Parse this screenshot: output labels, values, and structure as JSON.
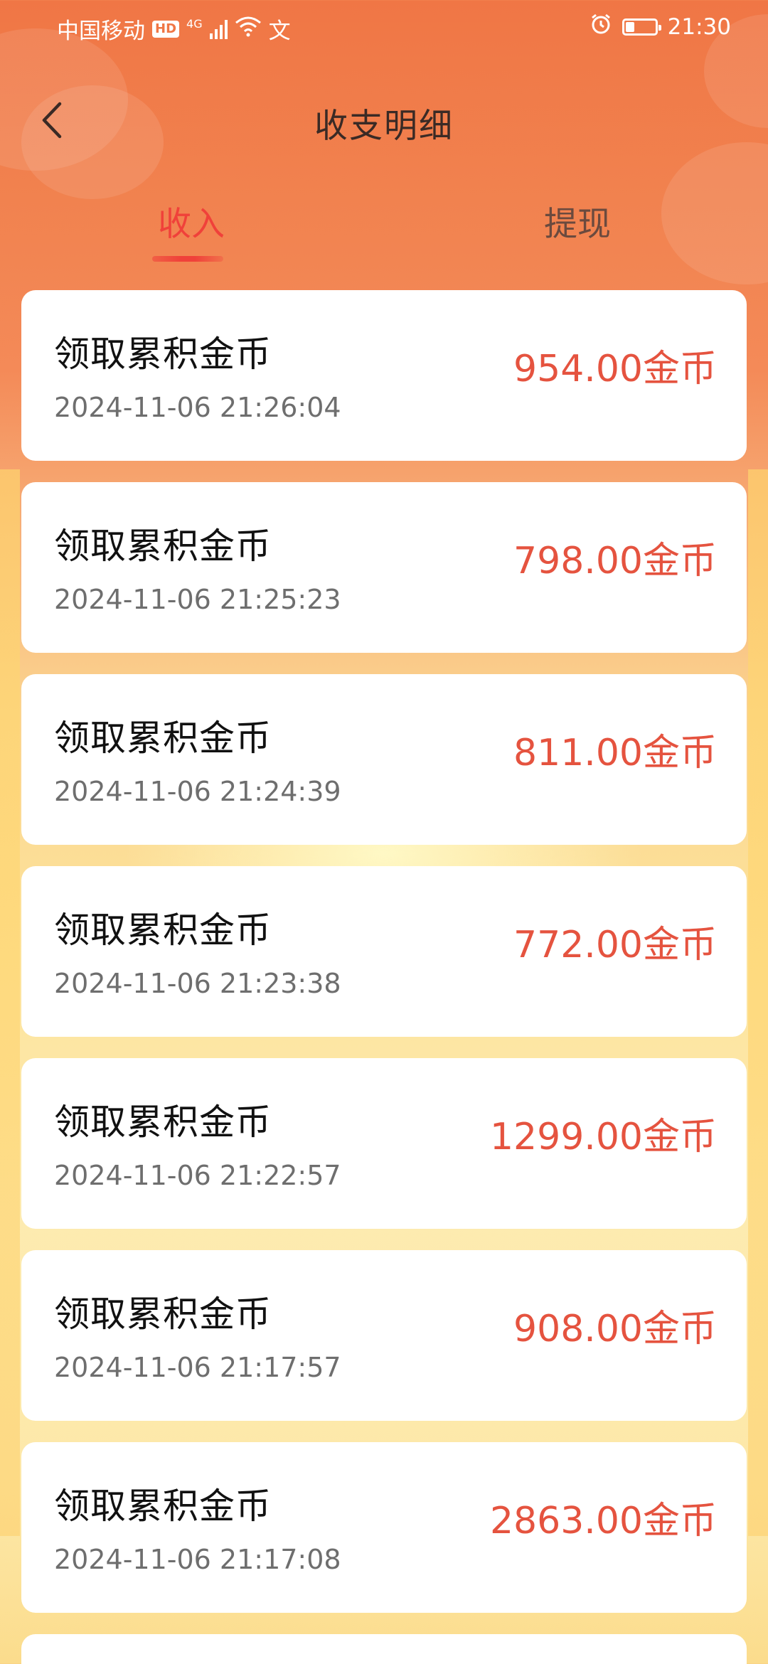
{
  "status_bar": {
    "carrier": "中国移动",
    "hd_badge": "HD",
    "network": "4G",
    "extra_icon": "文",
    "time": "21:30",
    "battery_level": 0.3
  },
  "header": {
    "title": "收支明细",
    "back_icon": "chevron-left-icon"
  },
  "tabs": [
    {
      "label": "收入",
      "active": true
    },
    {
      "label": "提现",
      "active": false
    }
  ],
  "records": [
    {
      "title": "领取累积金币",
      "time": "2024-11-06 21:26:04",
      "amount": "954.00金币"
    },
    {
      "title": "领取累积金币",
      "time": "2024-11-06 21:25:23",
      "amount": "798.00金币"
    },
    {
      "title": "领取累积金币",
      "time": "2024-11-06 21:24:39",
      "amount": "811.00金币"
    },
    {
      "title": "领取累积金币",
      "time": "2024-11-06 21:23:38",
      "amount": "772.00金币"
    },
    {
      "title": "领取累积金币",
      "time": "2024-11-06 21:22:57",
      "amount": "1299.00金币"
    },
    {
      "title": "领取累积金币",
      "time": "2024-11-06 21:17:57",
      "amount": "908.00金币"
    },
    {
      "title": "领取累积金币",
      "time": "2024-11-06 21:17:08",
      "amount": "2863.00金币"
    },
    {
      "title": "",
      "time": "",
      "amount": ""
    }
  ],
  "colors": {
    "accent_red": "#f0413a",
    "amount_red": "#e5533f",
    "header_orange": "#f07645"
  }
}
